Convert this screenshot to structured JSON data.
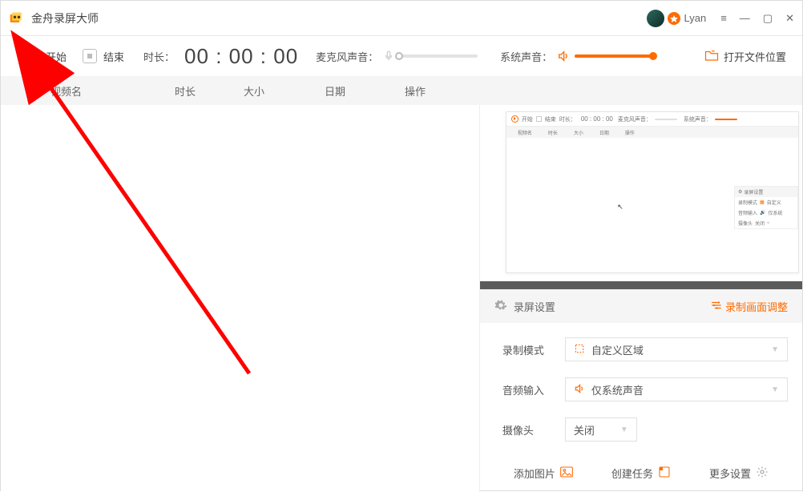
{
  "app": {
    "title": "金舟录屏大师"
  },
  "user": {
    "name": "Lyan"
  },
  "toolbar": {
    "start_label": "开始",
    "end_label": "结束",
    "duration_label": "时长：",
    "timer": "00 : 00 : 00",
    "mic_label": "麦克风声音：",
    "sys_label": "系统声音：",
    "open_folder_label": "打开文件位置"
  },
  "columns": {
    "name": "视频名",
    "duration": "时长",
    "size": "大小",
    "date": "日期",
    "operate": "操作"
  },
  "preview": {
    "start": "开始",
    "end": "结束",
    "dur_lab": "时长：",
    "timer": "00 : 00 : 00",
    "mic": "麦克风声音：",
    "sys": "系统声音：",
    "col_name": "视频名",
    "col_dur": "时长",
    "col_size": "大小",
    "col_date": "日期",
    "col_op": "操作",
    "settings_title": "录屏设置",
    "mode_lab": "录制模式",
    "mode_val": "自定义",
    "audio_lab": "音频输入",
    "audio_val": "仅系统",
    "cam_lab": "摄像头",
    "cam_val": "关闭"
  },
  "settings": {
    "header_title": "录屏设置",
    "adjust_link": "录制画面调整",
    "mode_label": "录制模式",
    "mode_value": "自定义区域",
    "audio_label": "音频输入",
    "audio_value": "仅系统声音",
    "camera_label": "摄像头",
    "camera_value": "关闭"
  },
  "actions": {
    "add_image": "添加图片",
    "create_task": "创建任务",
    "more_settings": "更多设置"
  }
}
